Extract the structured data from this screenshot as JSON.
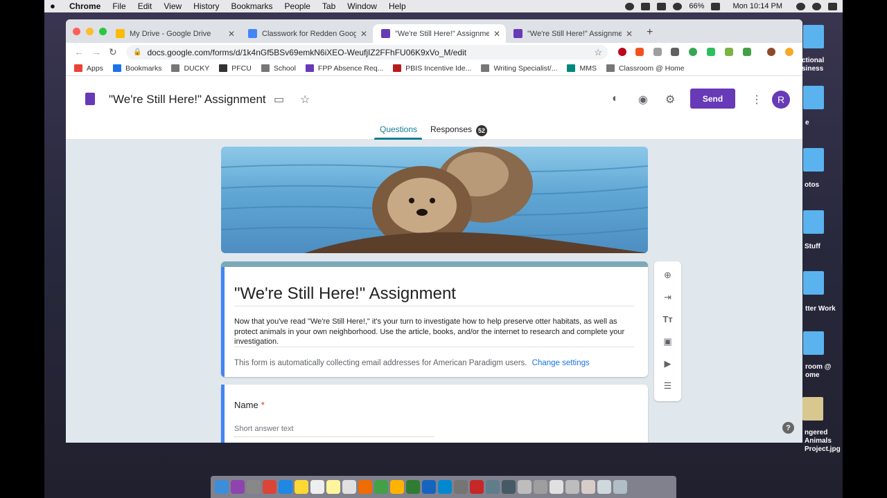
{
  "menubar": {
    "app": "Chrome",
    "items": [
      "File",
      "Edit",
      "View",
      "History",
      "Bookmarks",
      "People",
      "Tab",
      "Window",
      "Help"
    ],
    "battery": "66%",
    "clock": "Mon 10:14 PM"
  },
  "desktop_icons": [
    {
      "label": "ctional\nsiness"
    },
    {
      "label": "e"
    },
    {
      "label": "otos"
    },
    {
      "label": "Stuff"
    },
    {
      "label": "tter Work"
    },
    {
      "label": "room @\nome"
    },
    {
      "label": "ngered\nAnimals Project.jpg"
    }
  ],
  "browser": {
    "tabs": [
      {
        "title": "My Drive - Google Drive",
        "color": "#fbbc04"
      },
      {
        "title": "Classwork for Redden Google",
        "color": "#4285f4"
      },
      {
        "title": "\"We're Still Here!\" Assignment",
        "color": "#673ab7"
      },
      {
        "title": "\"We're Still Here!\" Assignment",
        "color": "#673ab7"
      }
    ],
    "url": "docs.google.com/forms/d/1k4nGf5BSv69emkN6iXEO-WeufjIZ2FFhFU06K9xVo_M/edit",
    "bookmarks": [
      "Apps",
      "Bookmarks",
      "DUCKY",
      "PFCU",
      "School",
      "FPP Absence Req...",
      "PBIS Incentive Ide...",
      "Writing Specialist/...",
      "MMS",
      "Classroom @ Home"
    ]
  },
  "forms": {
    "title": "\"We're Still Here!\" Assignment",
    "send_label": "Send",
    "avatar_letter": "R",
    "tab_questions": "Questions",
    "tab_responses": "Responses",
    "responses_count": "52",
    "card_title": "\"We're Still Here!\" Assignment",
    "description": "Now that you've read \"We're Still Here!,\" it's your turn to investigate how to help preserve otter habitats, as well as protect animals in your own neighborhood. Use the article, books, and/or the internet to research and complete your investigation.",
    "notice": "This form is automatically collecting email addresses for American Paradigm users.",
    "change_settings": "Change settings",
    "question_label": "Name",
    "required_mark": "*",
    "short_answer_placeholder": "Short answer text",
    "help_label": "?"
  }
}
